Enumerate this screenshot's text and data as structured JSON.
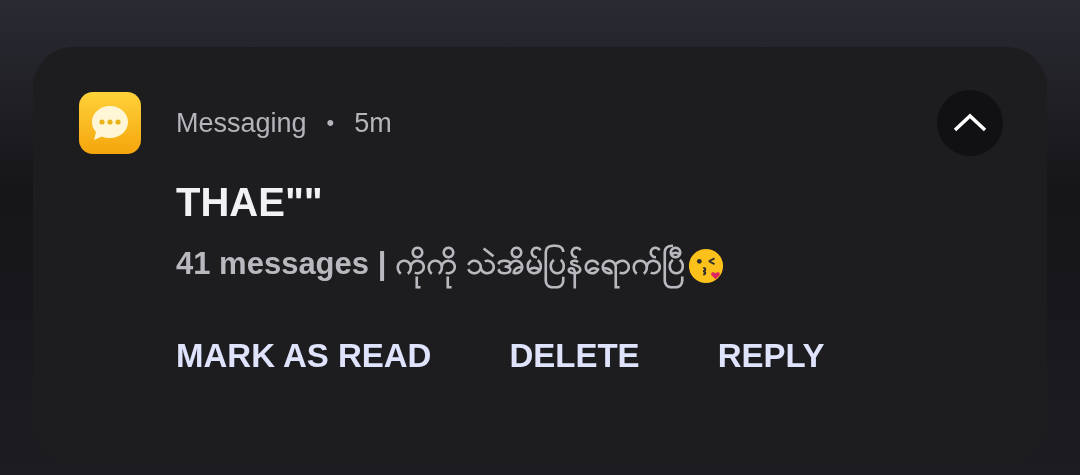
{
  "notification": {
    "app_name": "Messaging",
    "separator": "•",
    "time": "5m",
    "expanded": true,
    "title": "THAE\"\"",
    "message": "41 messages | ကိုကို သဲအိမ်ပြန်ရောက်ပြီ",
    "actions": [
      "MARK AS READ",
      "DELETE",
      "REPLY"
    ]
  }
}
